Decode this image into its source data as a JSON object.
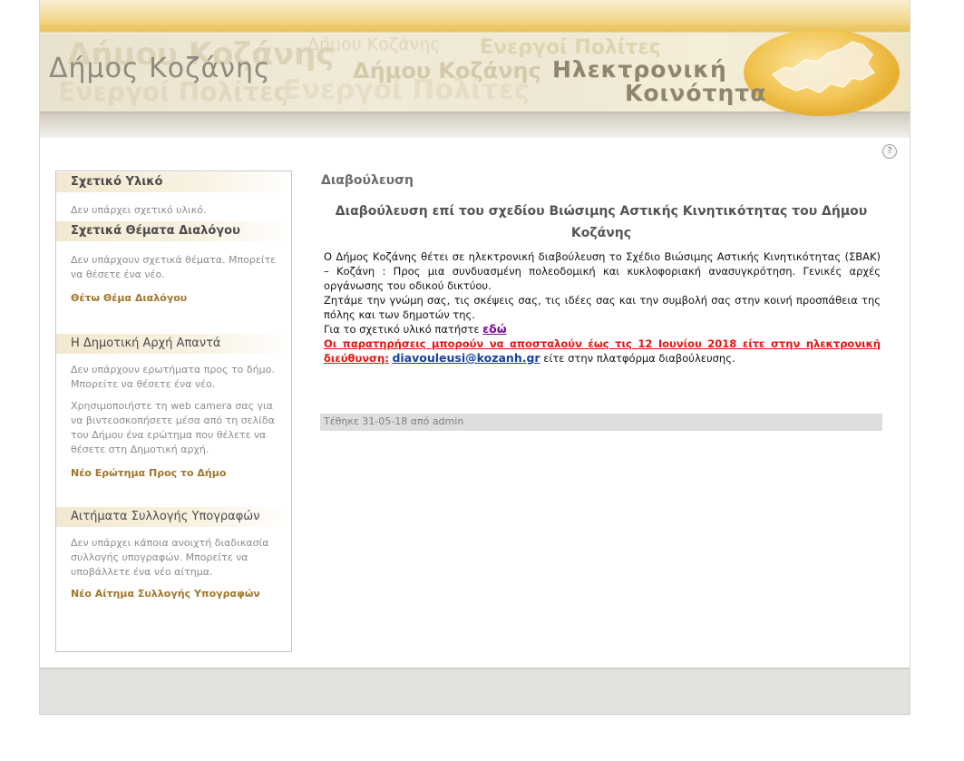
{
  "header": {
    "site_title": "Δήμος  Κοζάνης",
    "community_line1": "Ηλεκτρονική",
    "community_line2": "Κοινότητα",
    "ghost_texts": [
      "Δήμου Κοζάνης",
      "Ενεργοί Πολίτες",
      "Δήμου Κοζάνης",
      "Ενεργοί Πολίτες",
      "Ενεργοί Πολίτες",
      "Δήμου Κοζάνης"
    ]
  },
  "help": {
    "label": "?"
  },
  "sidebar": {
    "related_material": {
      "heading": "Σχετικό Υλικό",
      "text": "Δεν υπάρχει σχετικό υλικό."
    },
    "related_topics": {
      "heading": "Σχετικά Θέματα Διαλόγου",
      "text": "Δεν υπάρχουν σχετικά θέματα. Μπορείτε να θέσετε ένα νέο.",
      "link": "Θέτω Θέμα Διαλόγου"
    },
    "authority_answers": {
      "heading": "Η Δημοτική Αρχή Απαντά",
      "text1": "Δεν υπάρχουν ερωτήματα προς το δήμο. Μπορείτε να θέσετε ένα νέο.",
      "text2": "Χρησιμοποιήστε τη web camera σας για να βιντεοσκοπήσετε μέσα από τη σελίδα του Δήμου ένα ερώτημα που θέλετε να θέσετε στη Δημοτική αρχή.",
      "link": "Νέο Ερώτημα Προς το Δήμο"
    },
    "petitions": {
      "heading": "Αιτήματα Συλλογής Υπογραφών",
      "text": "Δεν υπάρχει κάποια ανοιχτή διαδικασία συλλογής υπογραφών. Μπορείτε να υποβάλλετε ένα νέο αίτημα.",
      "link": "Νέο Αίτημα Συλλογής Υπογραφών"
    }
  },
  "main": {
    "section_title": "Διαβούλευση",
    "article_title": "Διαβούλευση επί του σχεδίου Βιώσιμης Αστικής Κινητικότητας του Δήμου Κοζάνης",
    "paragraph1": "Ο Δήμος Κοζάνης θέτει σε ηλεκτρονική διαβούλευση το Σχέδιο Βιώσιμης Αστικής Κινητικότητας (ΣΒΑΚ) – Κοζάνη : Προς μια συνδυασμένη πολεοδομική και κυκλοφοριακή ανασυγκρότηση. Γενικές αρχές οργάνωσης του οδικού δικτύου.",
    "paragraph2": "Ζητάμε την γνώμη σας, τις σκέψεις σας, τις ιδέες σας και την συμβολή σας στην κοινή προσπάθεια της πόλης και των δημοτών της.",
    "material_prefix": "Για το σχετικό υλικό πατήστε ",
    "material_link": "εδώ",
    "deadline_text": "Οι παρατηρήσεις μπορούν να αποσταλούν έως τις 12 Ιουνίου 2018  είτε στην ηλεκτρονική διεύθυνση:",
    "email": "diavouleusi@kozanh.gr",
    "deadline_suffix": " είτε στην πλατφόρμα διαβούλευσης.",
    "posted": "Τέθηκε 31-05-18 από admin"
  }
}
